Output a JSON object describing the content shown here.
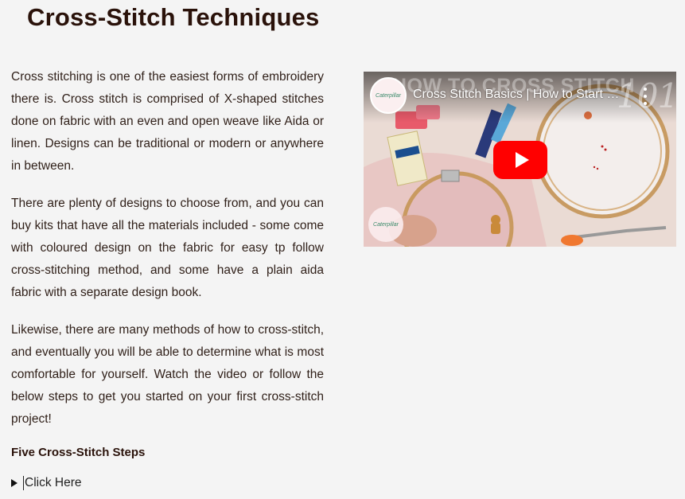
{
  "page": {
    "title": "Cross-Stitch Techniques"
  },
  "content": {
    "paragraphs": [
      "Cross stitching is one of the easiest forms of embroidery there is. Cross stitch is comprised of X-shaped stitches done on fabric with an even and open weave like Aida or linen. Designs can be traditional or modern or anywhere in between.",
      "There are plenty of designs to choose from, and you can buy kits that have all the materials included - some come with coloured design on the fabric for easy tp follow cross-stitching method, and some have a plain aida fabric with a separate design book.",
      "Likewise, there are many methods of how to cross-stitch, and eventually you will be able to determine what is most comfortable for yourself. Watch the video or follow the below steps to get you started on your first cross-stitch project!"
    ],
    "steps_heading": "Five Cross-Stitch Steps",
    "details_label": "Click Here"
  },
  "video": {
    "title": "Cross Stitch Basics | How to Start Cross Stitch",
    "background_caption": "HOW TO CROSS STITCH",
    "background_number": "101",
    "channel_name": "Caterpillar",
    "play_icon": "youtube-play-icon",
    "more_icon": "vertical-ellipsis-icon",
    "play_color": "#ff0000"
  },
  "colors": {
    "background": "#f4f4f4",
    "title_text": "#2a120a",
    "body_text": "#2f1f18"
  }
}
